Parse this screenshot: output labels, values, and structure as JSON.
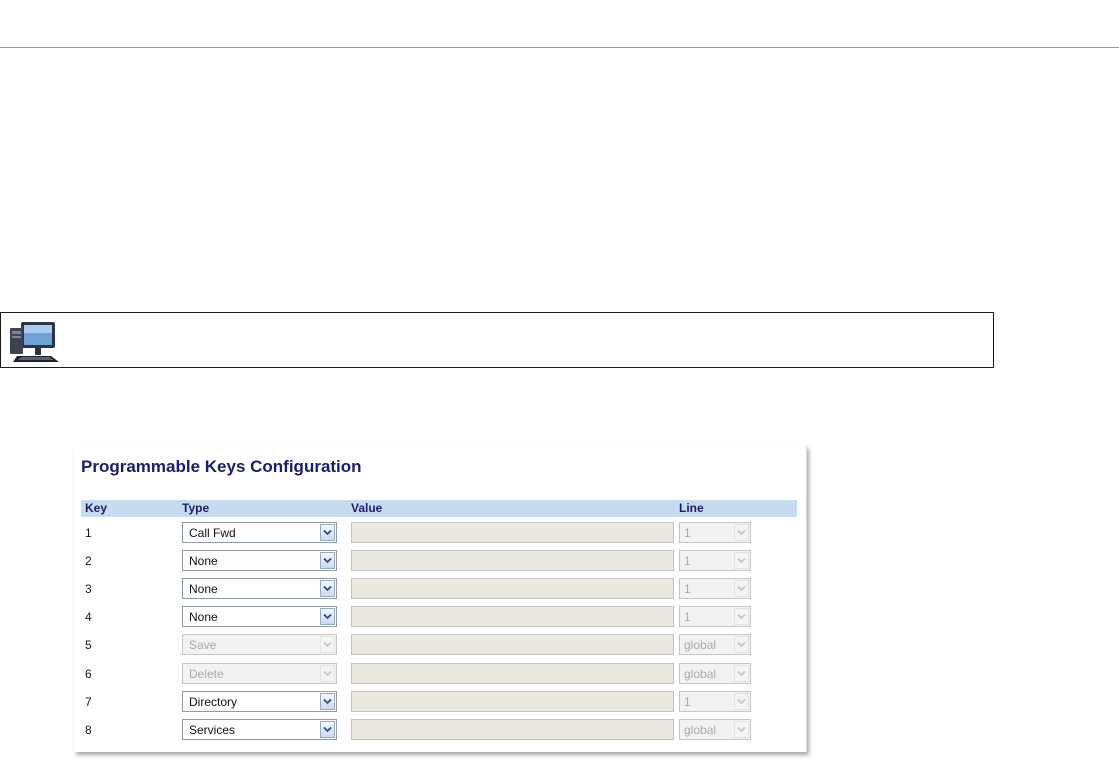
{
  "panel": {
    "title": "Programmable Keys Configuration",
    "columns": {
      "key": "Key",
      "type": "Type",
      "value": "Value",
      "line": "Line"
    },
    "rows": [
      {
        "key": "1",
        "type": "Call Fwd",
        "type_enabled": true,
        "value": "",
        "line": "1"
      },
      {
        "key": "2",
        "type": "None",
        "type_enabled": true,
        "value": "",
        "line": "1"
      },
      {
        "key": "3",
        "type": "None",
        "type_enabled": true,
        "value": "",
        "line": "1"
      },
      {
        "key": "4",
        "type": "None",
        "type_enabled": true,
        "value": "",
        "line": "1"
      },
      {
        "key": "5",
        "type": "Save",
        "type_enabled": false,
        "value": "",
        "line": "global"
      },
      {
        "key": "6",
        "type": "Delete",
        "type_enabled": false,
        "value": "",
        "line": "global"
      },
      {
        "key": "7",
        "type": "Directory",
        "type_enabled": true,
        "value": "",
        "line": "1"
      },
      {
        "key": "8",
        "type": "Services",
        "type_enabled": true,
        "value": "",
        "line": "global"
      }
    ]
  },
  "note": {
    "icon": "computer-icon"
  },
  "colors": {
    "title": "#1c1c6e",
    "header_bg": "#c8dcef",
    "value_bg": "#ece9e1"
  }
}
